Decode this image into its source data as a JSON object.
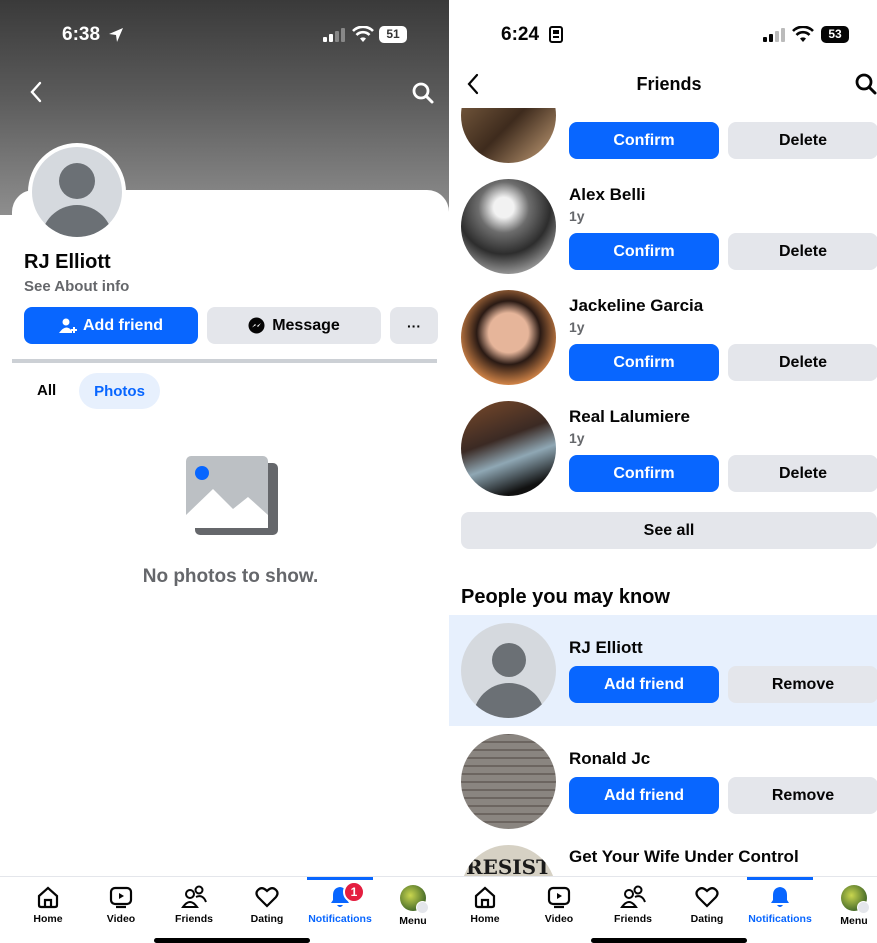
{
  "left": {
    "status": {
      "time": "6:38",
      "battery": "51"
    },
    "profile": {
      "name": "RJ Elliott",
      "subtitle": "See About info"
    },
    "actions": {
      "add_friend": "Add friend",
      "message": "Message",
      "more": "···"
    },
    "tabs": [
      {
        "label": "All"
      },
      {
        "label": "Photos"
      }
    ],
    "empty_state": "No photos to show.",
    "nav": [
      {
        "label": "Home"
      },
      {
        "label": "Video"
      },
      {
        "label": "Friends"
      },
      {
        "label": "Dating"
      },
      {
        "label": "Notifications",
        "badge": "1"
      },
      {
        "label": "Menu"
      }
    ]
  },
  "right": {
    "status": {
      "time": "6:24",
      "battery": "53"
    },
    "header": {
      "title": "Friends"
    },
    "requests": [
      {
        "name": "",
        "age": "",
        "confirm": "Confirm",
        "delete": "Delete"
      },
      {
        "name": "Alex Belli",
        "age": "1y",
        "confirm": "Confirm",
        "delete": "Delete"
      },
      {
        "name": "Jackeline Garcia",
        "age": "1y",
        "confirm": "Confirm",
        "delete": "Delete"
      },
      {
        "name": "Real Lalumiere",
        "age": "1y",
        "confirm": "Confirm",
        "delete": "Delete"
      }
    ],
    "see_all": "See all",
    "pymk_title": "People you may know",
    "pymk": [
      {
        "name": "RJ Elliott",
        "add": "Add friend",
        "remove": "Remove"
      },
      {
        "name": "Ronald Jc",
        "add": "Add friend",
        "remove": "Remove"
      },
      {
        "name": "Get Your Wife Under Control",
        "pic_text": "RESIST"
      }
    ],
    "nav": [
      {
        "label": "Home"
      },
      {
        "label": "Video"
      },
      {
        "label": "Friends"
      },
      {
        "label": "Dating"
      },
      {
        "label": "Notifications"
      },
      {
        "label": "Menu"
      }
    ]
  },
  "colors": {
    "accent": "#0866ff",
    "button_gray": "#e4e6eb",
    "highlight_row": "#e7f0fd",
    "badge_red": "#e41e3f"
  }
}
